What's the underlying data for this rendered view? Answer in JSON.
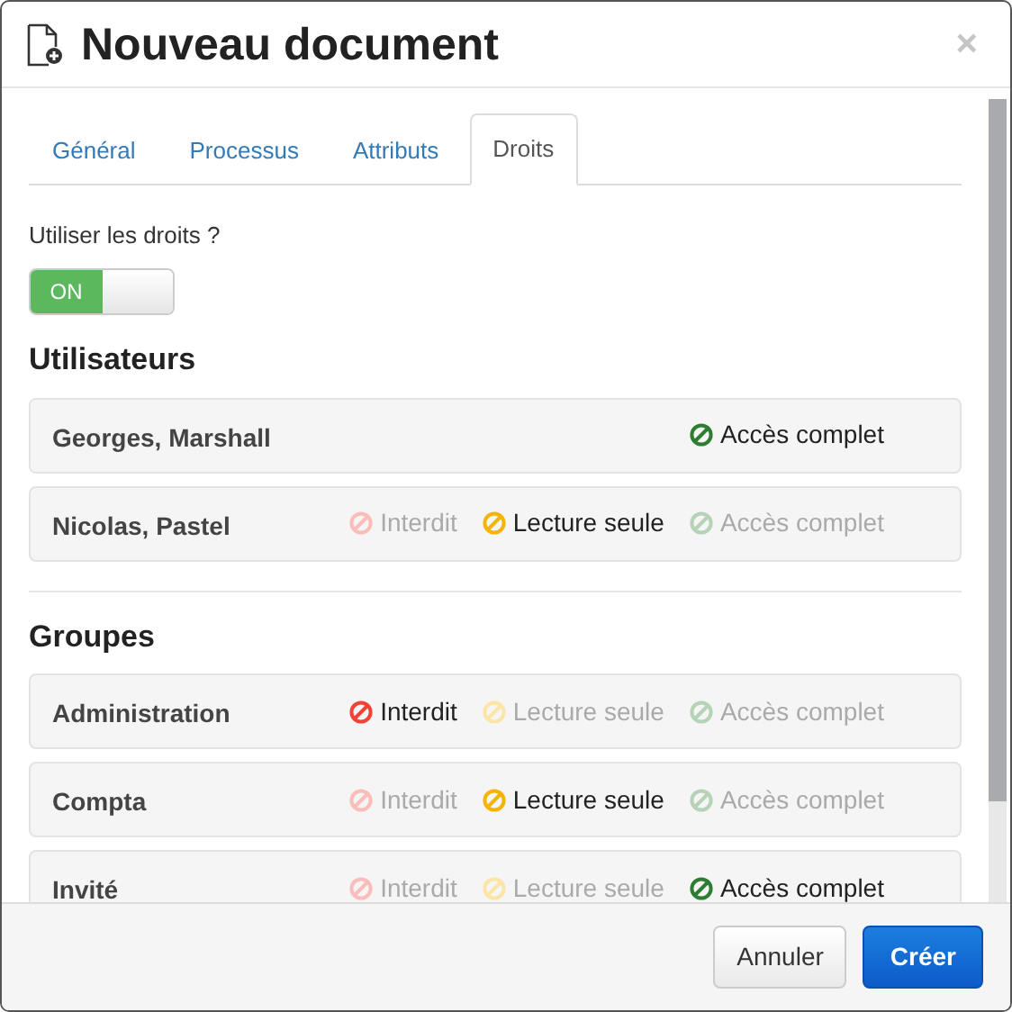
{
  "window": {
    "title": "Nouveau document",
    "close": "×"
  },
  "tabs": [
    {
      "label": "Général",
      "selected": false
    },
    {
      "label": "Processus",
      "selected": false
    },
    {
      "label": "Attributs",
      "selected": false
    },
    {
      "label": "Droits",
      "selected": true
    }
  ],
  "use_rights": {
    "label": "Utiliser les droits ?",
    "toggle": {
      "on": true,
      "on_label": "ON"
    }
  },
  "sections": [
    {
      "title": "Utilisateurs",
      "rows": [
        {
          "name": "Georges, Marshall",
          "options": [
            {
              "label": "Accès complet",
              "kind": "full",
              "selected": true
            }
          ]
        },
        {
          "name": "Nicolas, Pastel",
          "options": [
            {
              "label": "Interdit",
              "kind": "denied",
              "selected": false
            },
            {
              "label": "Lecture seule",
              "kind": "readonly",
              "selected": true
            },
            {
              "label": "Accès complet",
              "kind": "full",
              "selected": false
            }
          ]
        }
      ]
    },
    {
      "title": "Groupes",
      "rows": [
        {
          "name": "Administration",
          "options": [
            {
              "label": "Interdit",
              "kind": "denied",
              "selected": true
            },
            {
              "label": "Lecture seule",
              "kind": "readonly",
              "selected": false
            },
            {
              "label": "Accès complet",
              "kind": "full",
              "selected": false
            }
          ]
        },
        {
          "name": "Compta",
          "options": [
            {
              "label": "Interdit",
              "kind": "denied",
              "selected": false
            },
            {
              "label": "Lecture seule",
              "kind": "readonly",
              "selected": true
            },
            {
              "label": "Accès complet",
              "kind": "full",
              "selected": false
            }
          ]
        },
        {
          "name": "Invité",
          "options": [
            {
              "label": "Interdit",
              "kind": "denied",
              "selected": false
            },
            {
              "label": "Lecture seule",
              "kind": "readonly",
              "selected": false
            },
            {
              "label": "Accès complet",
              "kind": "full",
              "selected": true
            }
          ]
        }
      ]
    }
  ],
  "footer": {
    "buttons": [
      {
        "label": "Annuler",
        "kind": "secondary"
      },
      {
        "label": "Créer",
        "kind": "primary"
      }
    ]
  }
}
